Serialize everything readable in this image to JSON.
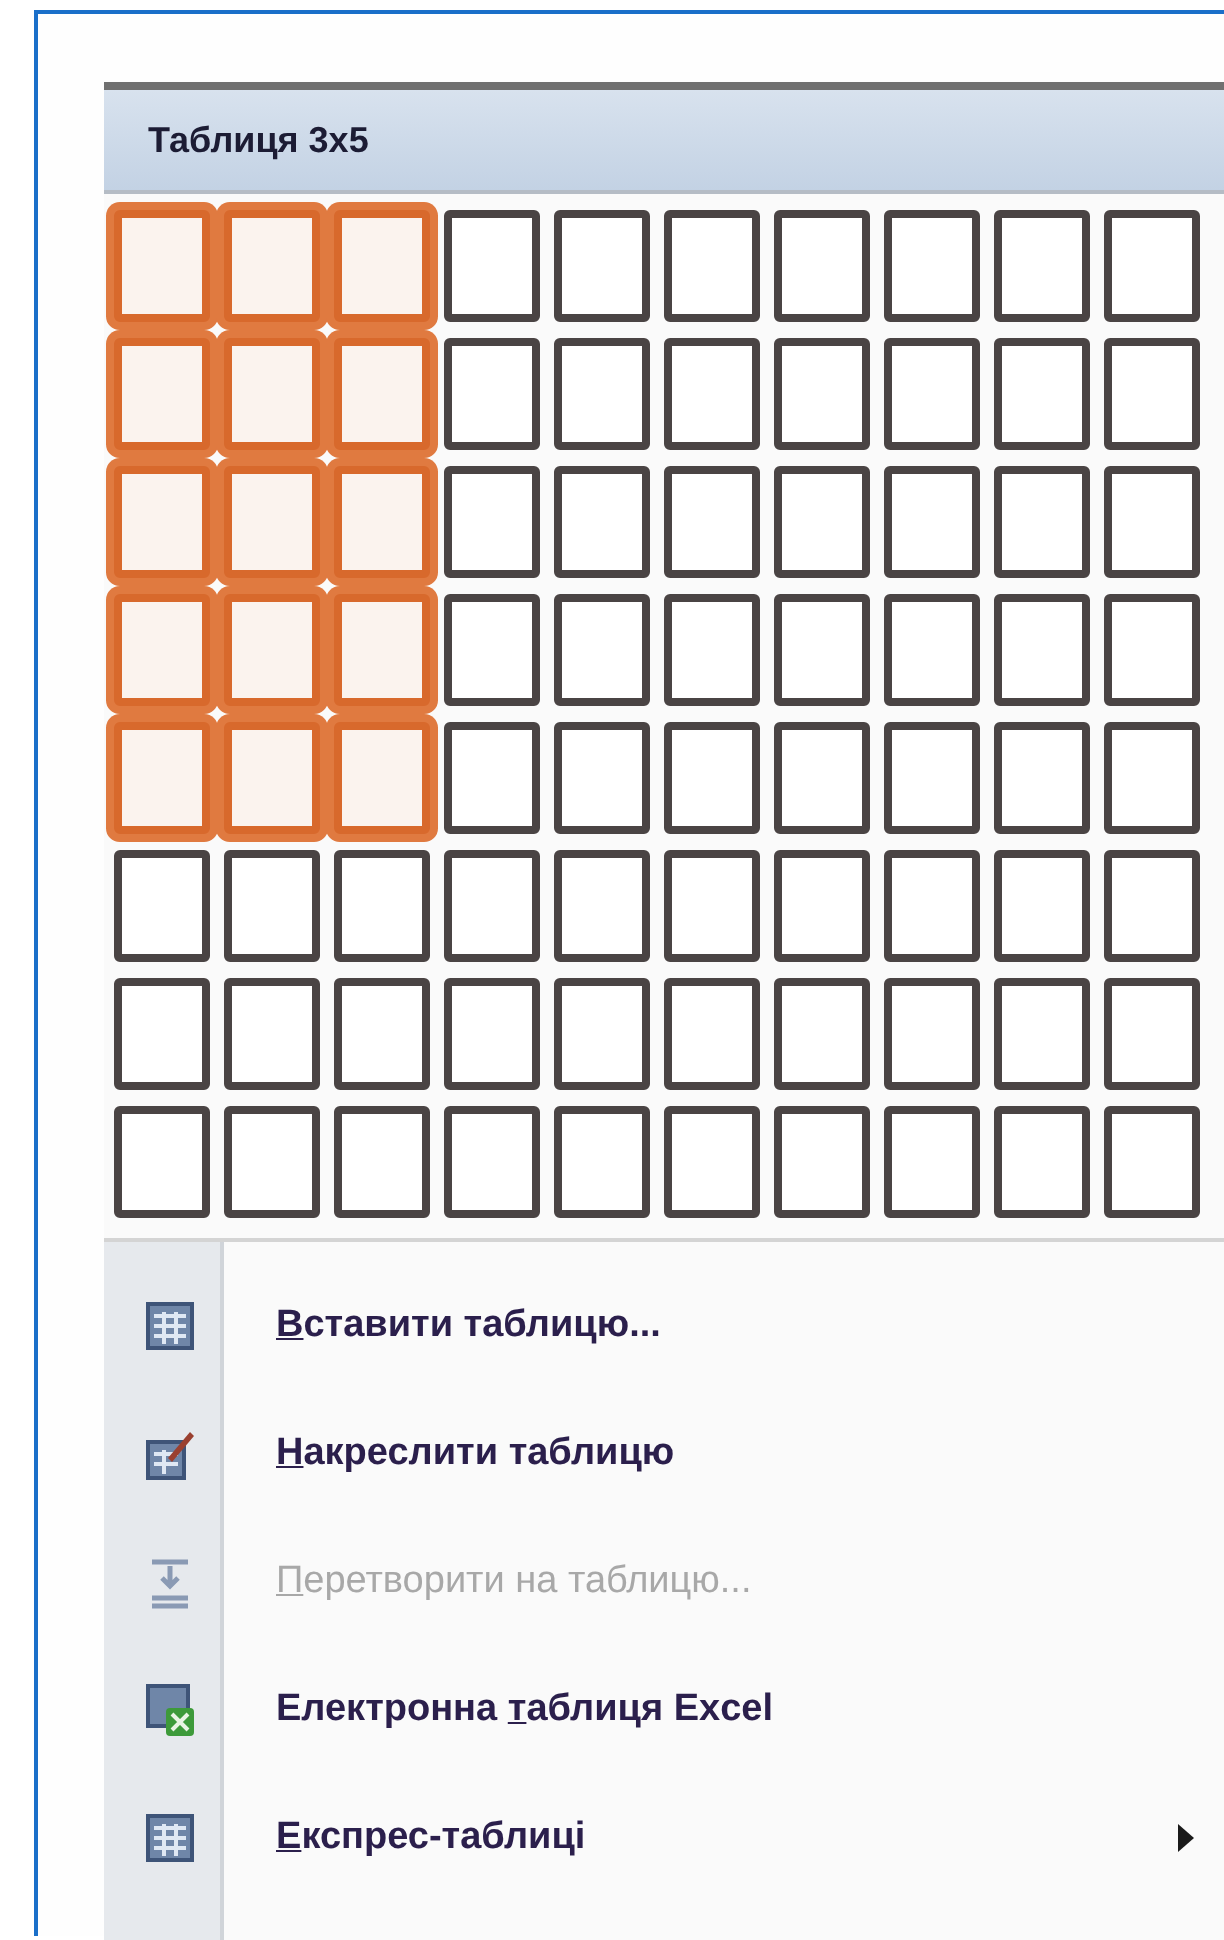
{
  "menu_title": "Таблиця 3x5",
  "grid": {
    "rows": [
      {
        "cells": [
          {
            "selected": true
          },
          {
            "selected": true
          },
          {
            "selected": true
          },
          {
            "selected": false
          },
          {
            "selected": false
          },
          {
            "selected": false
          },
          {
            "selected": false
          },
          {
            "selected": false
          },
          {
            "selected": false
          },
          {
            "selected": false
          }
        ]
      },
      {
        "cells": [
          {
            "selected": true
          },
          {
            "selected": true
          },
          {
            "selected": true
          },
          {
            "selected": false
          },
          {
            "selected": false
          },
          {
            "selected": false
          },
          {
            "selected": false
          },
          {
            "selected": false
          },
          {
            "selected": false
          },
          {
            "selected": false
          }
        ]
      },
      {
        "cells": [
          {
            "selected": true
          },
          {
            "selected": true
          },
          {
            "selected": true
          },
          {
            "selected": false
          },
          {
            "selected": false
          },
          {
            "selected": false
          },
          {
            "selected": false
          },
          {
            "selected": false
          },
          {
            "selected": false
          },
          {
            "selected": false
          }
        ]
      },
      {
        "cells": [
          {
            "selected": true
          },
          {
            "selected": true
          },
          {
            "selected": true
          },
          {
            "selected": false
          },
          {
            "selected": false
          },
          {
            "selected": false
          },
          {
            "selected": false
          },
          {
            "selected": false
          },
          {
            "selected": false
          },
          {
            "selected": false
          }
        ]
      },
      {
        "cells": [
          {
            "selected": true
          },
          {
            "selected": true
          },
          {
            "selected": true
          },
          {
            "selected": false
          },
          {
            "selected": false
          },
          {
            "selected": false
          },
          {
            "selected": false
          },
          {
            "selected": false
          },
          {
            "selected": false
          },
          {
            "selected": false
          }
        ]
      },
      {
        "cells": [
          {
            "selected": false
          },
          {
            "selected": false
          },
          {
            "selected": false
          },
          {
            "selected": false
          },
          {
            "selected": false
          },
          {
            "selected": false
          },
          {
            "selected": false
          },
          {
            "selected": false
          },
          {
            "selected": false
          },
          {
            "selected": false
          }
        ]
      },
      {
        "cells": [
          {
            "selected": false
          },
          {
            "selected": false
          },
          {
            "selected": false
          },
          {
            "selected": false
          },
          {
            "selected": false
          },
          {
            "selected": false
          },
          {
            "selected": false
          },
          {
            "selected": false
          },
          {
            "selected": false
          },
          {
            "selected": false
          }
        ]
      },
      {
        "cells": [
          {
            "selected": false
          },
          {
            "selected": false
          },
          {
            "selected": false
          },
          {
            "selected": false
          },
          {
            "selected": false
          },
          {
            "selected": false
          },
          {
            "selected": false
          },
          {
            "selected": false
          },
          {
            "selected": false
          },
          {
            "selected": false
          }
        ]
      }
    ]
  },
  "menu_items": [
    {
      "kind": "table",
      "accesskey": "В",
      "label_after": "ставити таблицю...",
      "disabled": false,
      "submenu": false
    },
    {
      "kind": "draw",
      "accesskey": "Н",
      "label_after": "акреслити таблицю",
      "disabled": false,
      "submenu": false
    },
    {
      "kind": "convert",
      "accesskey": "П",
      "label_after": "еретворити на таблицю...",
      "disabled": true,
      "submenu": false
    },
    {
      "kind": "excel",
      "label_before": "Електронна ",
      "accesskey": "т",
      "label_after": "аблиця Excel",
      "disabled": false,
      "submenu": false
    },
    {
      "kind": "table",
      "accesskey": "Е",
      "label_after": "кспрес-таблиці",
      "disabled": false,
      "submenu": true
    }
  ]
}
